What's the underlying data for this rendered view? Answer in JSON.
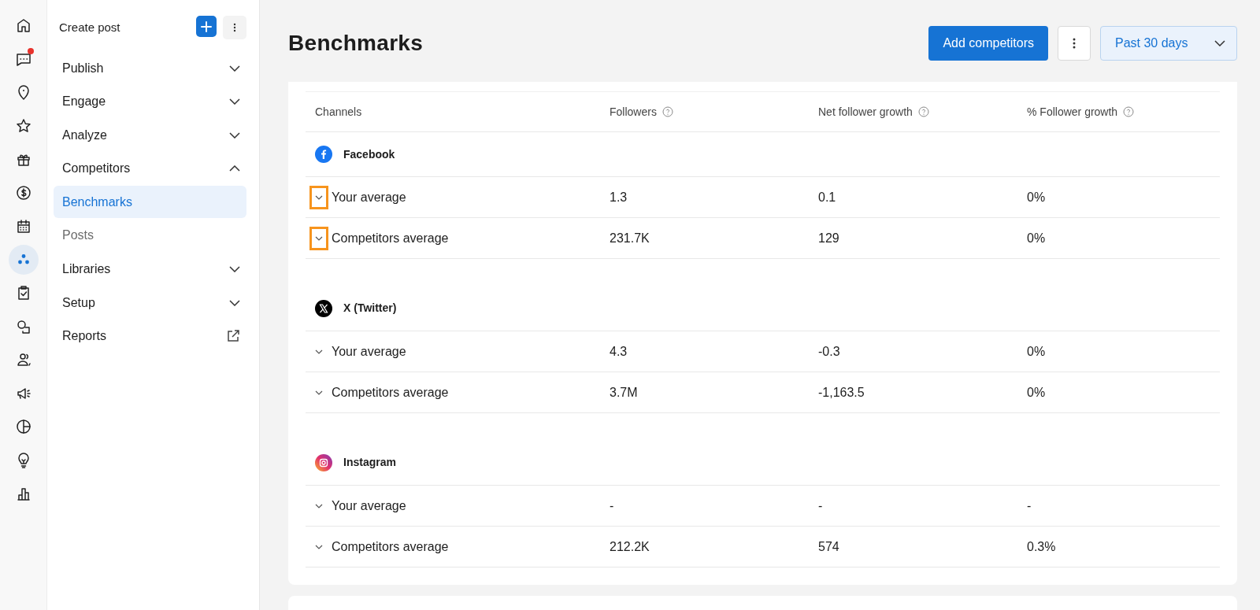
{
  "rail": [
    {
      "selected": false,
      "notification": false
    },
    {
      "selected": false,
      "notification": true
    },
    {
      "selected": false,
      "notification": false
    },
    {
      "selected": false,
      "notification": false
    },
    {
      "selected": false,
      "notification": false
    },
    {
      "selected": false,
      "notification": false
    },
    {
      "selected": false,
      "notification": false
    },
    {
      "selected": true,
      "notification": false
    },
    {
      "selected": false,
      "notification": false
    },
    {
      "selected": false,
      "notification": false
    },
    {
      "selected": false,
      "notification": false
    },
    {
      "selected": false,
      "notification": false
    },
    {
      "selected": false,
      "notification": false
    },
    {
      "selected": false,
      "notification": false
    },
    {
      "selected": false,
      "notification": false
    }
  ],
  "sidebar": {
    "create_post": "Create post",
    "items": [
      {
        "kind": "group",
        "label": "Publish",
        "expanded": false
      },
      {
        "kind": "group",
        "label": "Engage",
        "expanded": false
      },
      {
        "kind": "group",
        "label": "Analyze",
        "expanded": false
      },
      {
        "kind": "group",
        "label": "Competitors",
        "expanded": true
      },
      {
        "kind": "sub",
        "label": "Benchmarks",
        "selected": true
      },
      {
        "kind": "sub",
        "label": "Posts",
        "selected": false
      },
      {
        "kind": "group",
        "label": "Libraries",
        "expanded": false
      },
      {
        "kind": "group",
        "label": "Setup",
        "expanded": false
      },
      {
        "kind": "link",
        "label": "Reports"
      }
    ]
  },
  "header": {
    "title": "Benchmarks",
    "add_button": "Add competitors",
    "range": "Past 30 days"
  },
  "table": {
    "columns": [
      {
        "label": "Channels",
        "help": false
      },
      {
        "label": "Followers",
        "help": true
      },
      {
        "label": "Net follower growth",
        "help": true
      },
      {
        "label": "% Follower growth",
        "help": true
      }
    ],
    "sections": [
      {
        "kind": "facebook",
        "channel": "Facebook",
        "rows": [
          {
            "label": "Your average",
            "values": [
              "1.3",
              "0.1",
              "0%"
            ],
            "highlighted": true
          },
          {
            "label": "Competitors average",
            "values": [
              "231.7K",
              "129",
              "0%"
            ],
            "highlighted": true
          }
        ]
      },
      {
        "kind": "x",
        "channel": "X (Twitter)",
        "rows": [
          {
            "label": "Your average",
            "values": [
              "4.3",
              "-0.3",
              "0%"
            ],
            "highlighted": false
          },
          {
            "label": "Competitors average",
            "values": [
              "3.7M",
              "-1,163.5",
              "0%"
            ],
            "highlighted": false
          }
        ]
      },
      {
        "kind": "instagram",
        "channel": "Instagram",
        "rows": [
          {
            "label": "Your average",
            "values": [
              "-",
              "-",
              "-"
            ],
            "highlighted": false
          },
          {
            "label": "Competitors average",
            "values": [
              "212.2K",
              "574",
              "0.3%"
            ],
            "highlighted": false
          }
        ]
      }
    ]
  }
}
